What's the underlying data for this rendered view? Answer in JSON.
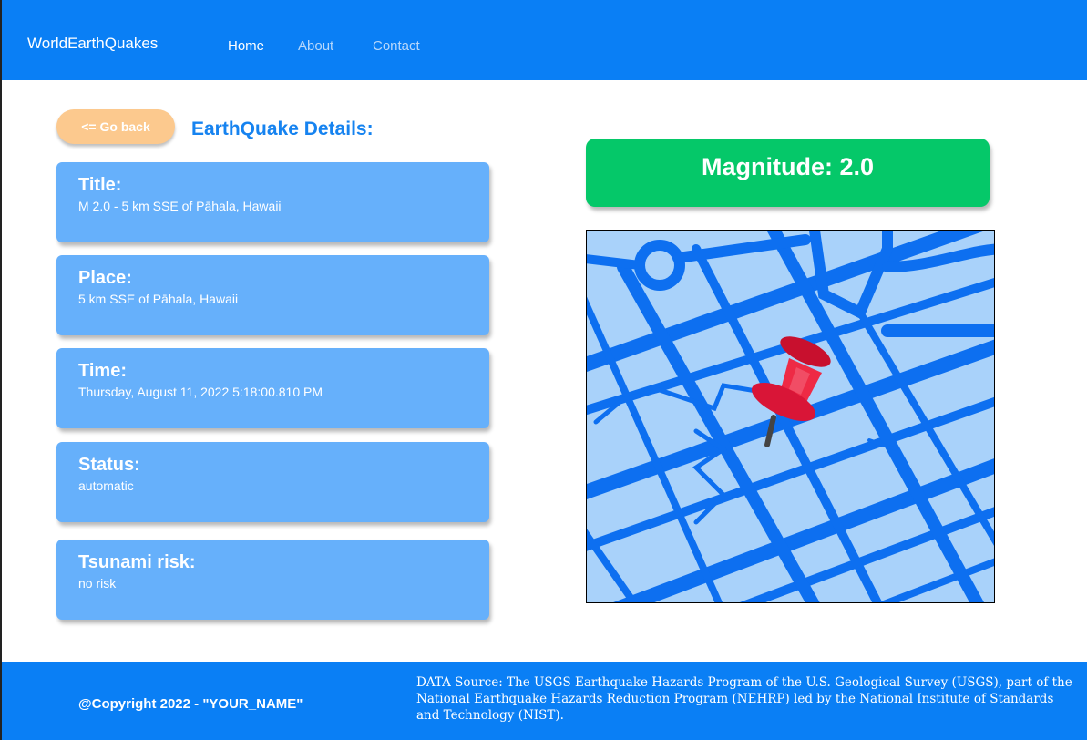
{
  "nav": {
    "brand": "WorldEarthQuakes",
    "links": [
      {
        "label": "Home",
        "active": true
      },
      {
        "label": "About",
        "active": false
      },
      {
        "label": "Contact",
        "active": false
      }
    ]
  },
  "details": {
    "back_label": "<= Go back",
    "heading": "EarthQuake Details:",
    "cards": [
      {
        "label": "Title:",
        "value": "M 2.0 - 5 km SSE of Pāhala, Hawaii"
      },
      {
        "label": "Place:",
        "value": "5 km SSE of Pāhala, Hawaii"
      },
      {
        "label": "Time:",
        "value": "Thursday, August 11, 2022 5:18:00.810 PM"
      },
      {
        "label": "Status:",
        "value": "automatic"
      },
      {
        "label": "Tsunami risk:",
        "value": "no risk"
      }
    ]
  },
  "magnitude": {
    "text": "Magnitude: 2.0"
  },
  "map": {
    "icon": "map-pin-icon"
  },
  "footer": {
    "copyright": "@Copyright 2022 - \"YOUR_NAME\"",
    "source": "DATA Source: The USGS Earthquake Hazards Program of the U.S. Geological Survey (USGS), part of the National Earthquake Hazards Reduction Program (NEHRP) led by the National Institute of Standards and Technology (NIST)."
  },
  "colors": {
    "nav_bg": "#0a7ff5",
    "card_bg": "#66b0fb",
    "magnitude_bg": "#05c869",
    "back_button_bg": "#fcc98e",
    "heading": "#1683f0"
  }
}
